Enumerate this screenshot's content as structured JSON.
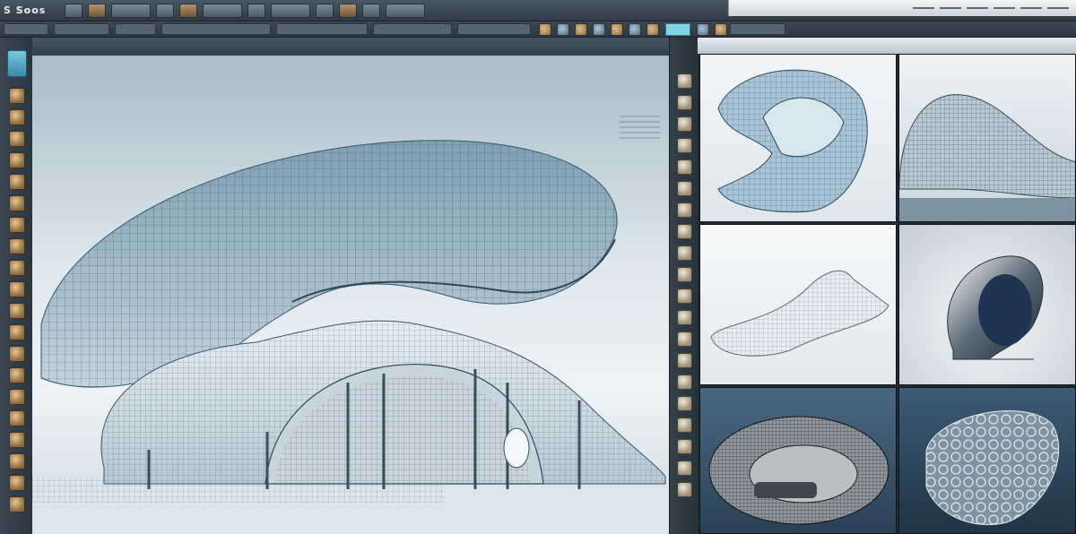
{
  "app": {
    "title": "S Soos",
    "accent_color": "#7fd5e6",
    "warm_icon_color": "#e2c08c"
  },
  "menubar": {
    "buttons": [
      "",
      "",
      "",
      "",
      "",
      "",
      "",
      "",
      "",
      "",
      "",
      "",
      "",
      ""
    ]
  },
  "left_tools": {
    "icons": [
      "select-tool-icon",
      "move-tool-icon",
      "rotate-tool-icon",
      "scale-tool-icon",
      "mesh-tool-icon",
      "extrude-tool-icon",
      "loop-tool-icon",
      "knife-tool-icon",
      "bevel-tool-icon",
      "bridge-tool-icon",
      "smooth-tool-icon",
      "sculpt-tool-icon",
      "grab-tool-icon",
      "pinch-tool-icon",
      "inflate-tool-icon",
      "crease-tool-icon",
      "snap-tool-icon",
      "measure-tool-icon",
      "camera-tool-icon",
      "light-tool-icon",
      "render-tool-icon"
    ],
    "active_index": 0
  },
  "mid_tools": {
    "icons": [
      "asset-icon",
      "material-icon",
      "texture-icon",
      "layer-icon",
      "object-icon",
      "modifier-icon",
      "constraint-icon",
      "data-icon",
      "particle-icon",
      "physics-icon",
      "scene-icon",
      "world-icon",
      "render-settings-icon",
      "output-icon",
      "view-layer-icon",
      "collection-icon",
      "camera-data-icon",
      "light-data-icon",
      "bone-icon",
      "shape-key-icon"
    ]
  },
  "gallery": {
    "thumbnails": [
      {
        "name": "thumb-curved-shell"
      },
      {
        "name": "thumb-wave-canopy"
      },
      {
        "name": "thumb-shoe-form"
      },
      {
        "name": "thumb-chrome-hood"
      },
      {
        "name": "thumb-oval-dish"
      },
      {
        "name": "thumb-lattice-ring"
      }
    ]
  }
}
